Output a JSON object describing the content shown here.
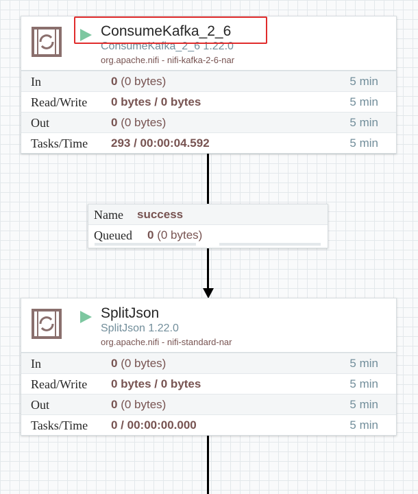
{
  "processors": [
    {
      "name": "ConsumeKafka_2_6",
      "type": "ConsumeKafka_2_6 1.22.0",
      "bundle": "org.apache.nifi - nifi-kafka-2-6-nar",
      "state": "running",
      "in": {
        "label": "In",
        "count": "0",
        "size": "(0 bytes)",
        "window": "5 min"
      },
      "read_write": {
        "label": "Read/Write",
        "value": "0 bytes / 0 bytes",
        "window": "5 min"
      },
      "out": {
        "label": "Out",
        "count": "0",
        "size": "(0 bytes)",
        "window": "5 min"
      },
      "tasks": {
        "label": "Tasks/Time",
        "value": "293 / 00:00:04.592",
        "window": "5 min"
      }
    },
    {
      "name": "SplitJson",
      "type": "SplitJson 1.22.0",
      "bundle": "org.apache.nifi - nifi-standard-nar",
      "state": "running",
      "in": {
        "label": "In",
        "count": "0",
        "size": "(0 bytes)",
        "window": "5 min"
      },
      "read_write": {
        "label": "Read/Write",
        "value": "0 bytes / 0 bytes",
        "window": "5 min"
      },
      "out": {
        "label": "Out",
        "count": "0",
        "size": "(0 bytes)",
        "window": "5 min"
      },
      "tasks": {
        "label": "Tasks/Time",
        "value": "0 / 00:00:00.000",
        "window": "5 min"
      }
    }
  ],
  "connection": {
    "name_label": "Name",
    "name": "success",
    "queued_label": "Queued",
    "queued_count": "0",
    "queued_size": "(0 bytes)"
  },
  "colors": {
    "running_icon": "#7dc7a0",
    "highlight": "#e02b2b",
    "stat_value": "#775351",
    "type_text": "#728e9b"
  }
}
